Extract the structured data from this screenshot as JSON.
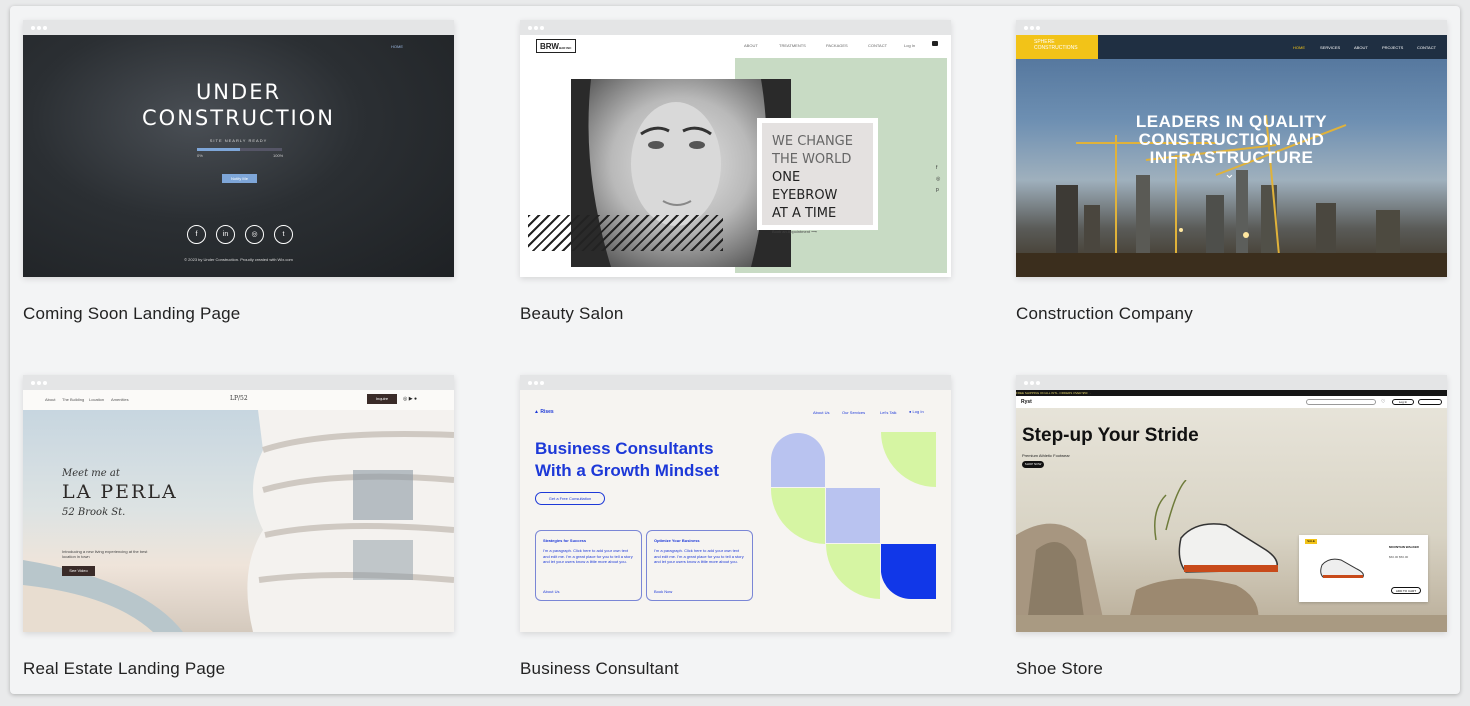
{
  "templates": [
    {
      "name": "Coming Soon Landing Page",
      "preview": {
        "nav": "HOME",
        "headline_1": "UNDER",
        "headline_2": "CONSTRUCTION",
        "subline": "SITE NEARLY READY",
        "progress_start": "0%",
        "progress_end": "100%",
        "progress_value": 0.5,
        "button": "Notify Me",
        "footer": "© 2023 by Under Construction. Proudly created with Wix.com",
        "social": [
          "f",
          "in",
          "◎",
          "t"
        ]
      }
    },
    {
      "name": "Beauty Salon",
      "preview": {
        "logo": "BRW",
        "logo_sub": "BAR INC",
        "nav": [
          "ABOUT",
          "TREATMENTS",
          "PACKAGES",
          "CONTACT"
        ],
        "login": "Log In",
        "headline": [
          "WE CHANGE",
          "THE WORLD",
          "ONE EYEBROW",
          "AT A TIME"
        ],
        "cta": "Book an Appointment"
      }
    },
    {
      "name": "Construction Company",
      "preview": {
        "logo_line1": "SPHERE",
        "logo_line2": "CONSTRUCTIONS",
        "nav": [
          "HOME",
          "SERVICES",
          "ABOUT",
          "PROJECTS",
          "CONTACT"
        ],
        "headline": [
          "LEADERS IN QUALITY",
          "CONSTRUCTION AND",
          "INFRASTRUCTURE"
        ]
      }
    },
    {
      "name": "Real Estate Landing Page",
      "preview": {
        "nav": [
          "About",
          "The Building",
          "Location",
          "Amenities"
        ],
        "logo": "LP/52",
        "button_top": "Inquire",
        "kicker": "Meet me at",
        "title": "LA PERLA",
        "address": "52 Brook St.",
        "blurb": "Introducing a new living experiencing at the best location in town",
        "button": "See Video"
      }
    },
    {
      "name": "Business Consultant",
      "preview": {
        "logo": "Rises",
        "nav": [
          "About Us",
          "Our Services",
          "Let's Talk"
        ],
        "login": "Log In",
        "headline_1": "Business Consultants",
        "headline_2": "With a Growth Mindset",
        "cta": "Get a Free Consultation",
        "boxes": [
          {
            "title": "Strategies for Success",
            "body": "I'm a paragraph. Click here to add your own text and edit me. I'm a great place for you to tell a story and let your users know a little more about you.",
            "link": "About Us"
          },
          {
            "title": "Optimize Your Business",
            "body": "I'm a paragraph. Click here to add your own text and edit me. I'm a great place for you to tell a story and let your users know a little more about you.",
            "link": "Book Now"
          }
        ],
        "colors": {
          "brand": "#1d39d8",
          "lime": "#d6f5a3",
          "lavender": "#b9c3f0",
          "royal": "#1137e8"
        }
      }
    },
    {
      "name": "Shoe Store",
      "preview": {
        "ticker": "FREE SHIPPING ON ALL INTL. ORDERS OVER $50",
        "logo": "Ryst",
        "login": "Log In",
        "headline": "Step-up Your Stride",
        "subline": "Premium Athletic Footwear",
        "cta": "SHOP NOW",
        "tag": "SALE",
        "product_name": "MOUNTAIN WALKER",
        "product_price": "$60.00 $50.00",
        "add_to_cart": "ADD TO CART"
      }
    }
  ]
}
